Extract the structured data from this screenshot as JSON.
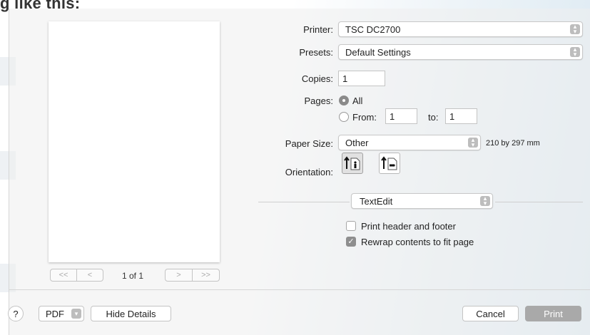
{
  "heading_fragment": "g like this:",
  "printer": {
    "label": "Printer:",
    "value": "TSC DC2700"
  },
  "presets": {
    "label": "Presets:",
    "value": "Default Settings"
  },
  "copies": {
    "label": "Copies:",
    "value": "1"
  },
  "pages": {
    "label": "Pages:",
    "all_label": "All",
    "from_label": "From:",
    "from_value": "1",
    "to_label": "to:",
    "to_value": "1",
    "selected": "All"
  },
  "paper_size": {
    "label": "Paper Size:",
    "value": "Other",
    "dimensions": "210 by 297 mm"
  },
  "orientation": {
    "label": "Orientation:",
    "options": [
      "portrait",
      "landscape"
    ],
    "selected": "portrait"
  },
  "app_section": {
    "value": "TextEdit"
  },
  "options": {
    "header_footer": {
      "label": "Print header and footer",
      "checked": false
    },
    "rewrap": {
      "label": "Rewrap contents to fit page",
      "checked": true
    }
  },
  "pager": {
    "first": "<<",
    "prev": "<",
    "label": "1 of 1",
    "next": ">",
    "last": ">>"
  },
  "footer": {
    "help": "?",
    "pdf": "PDF",
    "hide_details": "Hide Details",
    "cancel": "Cancel",
    "print": "Print"
  },
  "icons": {
    "stepper": "updown-chevron-icon",
    "dropdown": "chevron-down-icon",
    "check": "checkmark-icon"
  },
  "colors": {
    "accent_blue": "#3a73e0",
    "print_disabled": "#a9a9a9"
  }
}
